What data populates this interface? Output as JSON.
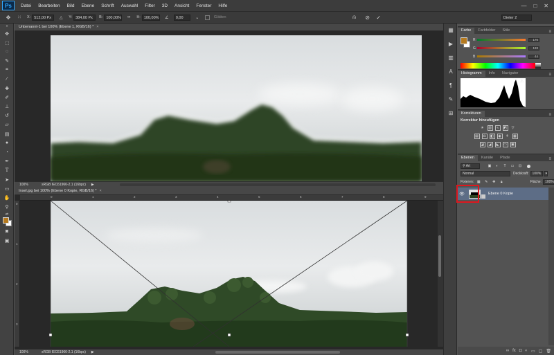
{
  "app": {
    "logo": "Ps"
  },
  "menu": [
    "Datei",
    "Bearbeiten",
    "Bild",
    "Ebene",
    "Schrift",
    "Auswahl",
    "Filter",
    "3D",
    "Ansicht",
    "Fenster",
    "Hilfe"
  ],
  "window_controls": [
    "—",
    "□",
    "✕"
  ],
  "options": {
    "x_label": "X:",
    "x_value": "512,00 Px",
    "y_label": "Y:",
    "y_value": "384,00 Px",
    "w_label": "B:",
    "w_value": "100,00%",
    "h_label": "H:",
    "h_value": "100,00%",
    "angle_value": "0,00",
    "smooth_label": "Glätten",
    "workspace": "Dieter 2"
  },
  "doc1": {
    "tab_title": "Unbenannt-1 bei 100% (Ebene 1, RGB/16) *",
    "zoom": "100%",
    "profile": "sRGB IEC61966-2.1 (16bpc)"
  },
  "doc2": {
    "tab_title": "Insel.jpg bei 100% (Ebene 0 Kopie, RGB/16) *",
    "zoom": "100%",
    "profile": "sRGB IEC61966-2.1 (16bpc)",
    "ruler_h": [
      "0",
      "1",
      "2",
      "3",
      "4",
      "5",
      "6",
      "7",
      "8",
      "9"
    ],
    "ruler_v": [
      "0",
      "1",
      "2",
      "3"
    ]
  },
  "color_panel": {
    "tabs": [
      "Farbe",
      "Farbfelder",
      "Stile"
    ],
    "letters": [
      "R",
      "G",
      "B"
    ],
    "values": [
      "170",
      "133",
      "44"
    ]
  },
  "histogram_panel": {
    "tabs": [
      "Histogramm",
      "Info",
      "Navigator"
    ]
  },
  "corrections_panel": {
    "tabs": [
      "Korrekturen"
    ],
    "heading": "Korrektur hinzufügen"
  },
  "layers_panel": {
    "tabs": [
      "Ebenen",
      "Kanäle",
      "Pfade"
    ],
    "filter": "Art",
    "blend_mode": "Normal",
    "opacity_label": "Deckkraft:",
    "opacity_value": "100%",
    "fix_label": "Fixieren:",
    "fill_label": "Fläche:",
    "fill_value": "100%",
    "layer_name": "Ebene 0 Kopie"
  },
  "colors": {
    "foreground": "#b57a1f",
    "background": "#ffffff",
    "highlight": "#e0161d",
    "selected_layer": "#5d6d86"
  }
}
